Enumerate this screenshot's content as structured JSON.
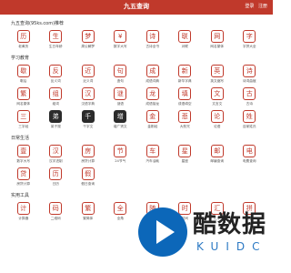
{
  "header": {
    "title": "九五查询",
    "links": [
      "登录",
      "注册"
    ]
  },
  "sections": [
    {
      "title": "九五查询(95ks.com)推荐",
      "items": [
        {
          "label": "老黄历",
          "glyph": "历",
          "style": "outline"
        },
        {
          "label": "生日年龄",
          "glyph": "生",
          "style": "outline"
        },
        {
          "label": "周公解梦",
          "glyph": "梦",
          "style": "outline"
        },
        {
          "label": "数字大写",
          "glyph": "¥",
          "style": "outline"
        },
        {
          "label": "古诗全书",
          "glyph": "诗",
          "style": "outline"
        },
        {
          "label": "对联",
          "glyph": "联",
          "style": "outline"
        },
        {
          "label": "网名繁体",
          "glyph": "网",
          "style": "outline"
        },
        {
          "label": "字拼大全",
          "glyph": "字",
          "style": "outline"
        }
      ]
    },
    {
      "title": "学习教育",
      "items": [
        {
          "label": "歇后",
          "glyph": "歇",
          "style": "outline"
        },
        {
          "label": "反义词",
          "glyph": "反",
          "style": "outline"
        },
        {
          "label": "近义词",
          "glyph": "近",
          "style": "outline"
        },
        {
          "label": "造句",
          "glyph": "句",
          "style": "outline"
        },
        {
          "label": "成语词典",
          "glyph": "成",
          "style": "outline"
        },
        {
          "label": "新华字典",
          "glyph": "新",
          "style": "outline"
        },
        {
          "label": "英文缩写",
          "glyph": "英",
          "style": "outline"
        },
        {
          "label": "诗词曲赋",
          "glyph": "诗",
          "style": "outline"
        },
        {
          "label": "网名繁体",
          "glyph": "繁",
          "style": "outline"
        },
        {
          "label": "组词",
          "glyph": "组",
          "style": "outline"
        },
        {
          "label": "汉语字典",
          "glyph": "汉",
          "style": "outline"
        },
        {
          "label": "谜语",
          "glyph": "谜",
          "style": "outline"
        },
        {
          "label": "成语接龙",
          "glyph": "龙",
          "style": "outline"
        },
        {
          "label": "成语填空",
          "glyph": "填",
          "style": "outline"
        },
        {
          "label": "文言文",
          "glyph": "文",
          "style": "outline"
        },
        {
          "label": "古诗",
          "glyph": "古",
          "style": "outline"
        },
        {
          "label": "三字经",
          "glyph": "三",
          "style": "outline"
        },
        {
          "label": "弟子规",
          "glyph": "弟",
          "style": "solid"
        },
        {
          "label": "千字文",
          "glyph": "千",
          "style": "solid"
        },
        {
          "label": "增广贤文",
          "glyph": "增",
          "style": "solid"
        },
        {
          "label": "金刚经",
          "glyph": "金",
          "style": "outline"
        },
        {
          "label": "大悲咒",
          "glyph": "悲",
          "style": "outline"
        },
        {
          "label": "论语",
          "glyph": "论",
          "style": "outline"
        },
        {
          "label": "百家姓氏",
          "glyph": "姓",
          "style": "outline"
        }
      ]
    },
    {
      "title": "日常生活",
      "items": [
        {
          "label": "数字大写",
          "glyph": "壹",
          "style": "outline"
        },
        {
          "label": "汉字进制",
          "glyph": "汉",
          "style": "outline"
        },
        {
          "label": "房贷计算",
          "glyph": "房",
          "style": "outline"
        },
        {
          "label": "24节气",
          "glyph": "节",
          "style": "outline"
        },
        {
          "label": "汽车油耗",
          "glyph": "车",
          "style": "outline"
        },
        {
          "label": "星座",
          "glyph": "星",
          "style": "outline"
        },
        {
          "label": "邮编查询",
          "glyph": "邮",
          "style": "outline"
        },
        {
          "label": "电费查询",
          "glyph": "电",
          "style": "outline"
        },
        {
          "label": "房贷计算",
          "glyph": "贷",
          "style": "outline"
        },
        {
          "label": "日历",
          "glyph": "历",
          "style": "outline"
        },
        {
          "label": "假日查询",
          "glyph": "假",
          "style": "outline"
        }
      ]
    },
    {
      "title": "实用工具",
      "items": [
        {
          "label": "计算器",
          "glyph": "计",
          "style": "outline"
        },
        {
          "label": "二维码",
          "glyph": "码",
          "style": "outline"
        },
        {
          "label": "繁简体",
          "glyph": "繁",
          "style": "outline"
        },
        {
          "label": "全角",
          "glyph": "全",
          "style": "outline"
        },
        {
          "label": "随机数",
          "glyph": "随",
          "style": "outline"
        },
        {
          "label": "时间",
          "glyph": "时",
          "style": "outline"
        },
        {
          "label": "汇率",
          "glyph": "汇",
          "style": "outline"
        },
        {
          "label": "拼音",
          "glyph": "拼",
          "style": "outline"
        }
      ]
    }
  ],
  "watermark": {
    "text": "酷数据",
    "sub": "KUIDC"
  }
}
